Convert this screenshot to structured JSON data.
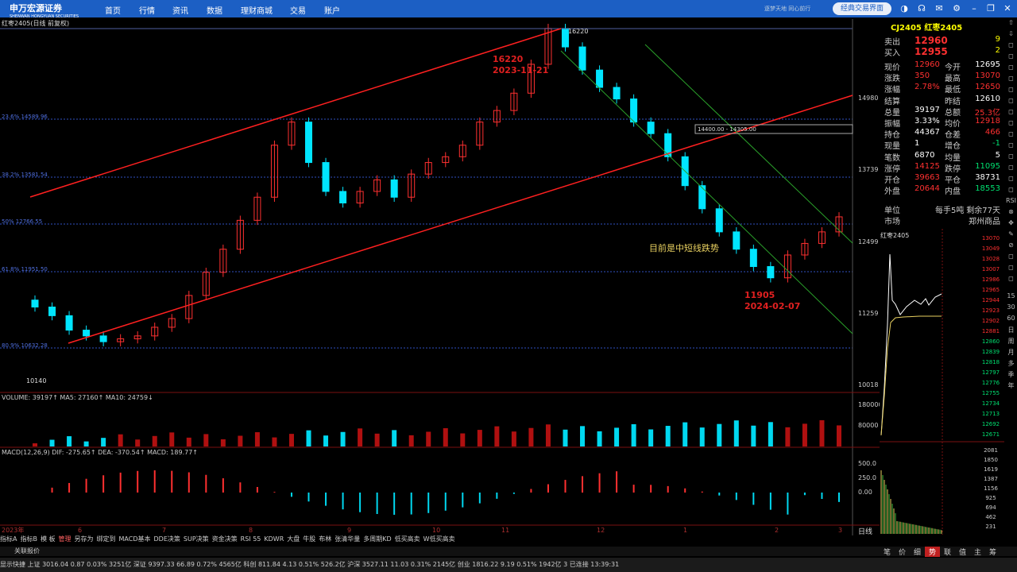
{
  "topbar": {
    "logo": "申万宏源证券",
    "logo_sub": "SHENWAN HONGYUAN SECURITIES",
    "nav": [
      "首页",
      "行情",
      "资讯",
      "数据",
      "理财商城",
      "交易",
      "账户"
    ],
    "slogan": "逐梦天地 同心前行",
    "classic_button": "经典交易界面"
  },
  "chart": {
    "title": "红枣2405(日线 前复权)",
    "fib_levels": [
      "23.6% 14589.96",
      "38.2% 13581.54",
      "50% 12766.55",
      "61.8% 11951.50",
      "80.9% 10632.28"
    ],
    "price_axis": [
      "14980",
      "13739",
      "12499",
      "11259",
      "10018"
    ],
    "peak_label": "16220",
    "low_label": "10140",
    "range_box_label": "14400.00 - 14305.00",
    "annotation_high": [
      "16220",
      "2023-11-21"
    ],
    "annotation_low": [
      "11905",
      "2024-02-07"
    ],
    "trend_note": "目前是中短线跌势",
    "volume_label": "VOLUME: 39197↑  MA5: 27160↑  MA10: 24759↓",
    "volume_axis": [
      "180000",
      "80000"
    ],
    "macd_label": "MACD(12,26,9)  DIF: -275.65↑  DEA: -370.54↑  MACD: 189.77↑",
    "macd_axis": [
      "500.0",
      "250.0",
      "0.00"
    ],
    "x_axis": [
      "2023年",
      "6",
      "7",
      "8",
      "9",
      "10",
      "11",
      "12",
      "1",
      "2",
      "3"
    ]
  },
  "chart_data": {
    "type": "candlestick",
    "colors": {
      "up": "#ff3030",
      "down": "#00e5ff",
      "trend": "#ff2020",
      "channel": "#2aa02a"
    },
    "ohlc_close_approx": [
      11400,
      11250,
      11000,
      10900,
      10800,
      10850,
      10900,
      11050,
      11200,
      11600,
      12000,
      12400,
      12900,
      13300,
      14200,
      14600,
      13900,
      13400,
      13200,
      13400,
      13600,
      13300,
      13700,
      13900,
      14000,
      14200,
      14600,
      14800,
      15100,
      15600,
      16220,
      15900,
      15500,
      15200,
      15000,
      14600,
      14400,
      14000,
      13500,
      13100,
      12700,
      12400,
      12100,
      11905,
      12300,
      12500,
      12700,
      12960
    ]
  },
  "quote": {
    "code": "CJ2405 红枣2405",
    "sell": {
      "label": "卖出",
      "price": "12960",
      "qty": "9"
    },
    "buy": {
      "label": "买入",
      "price": "12955",
      "qty": "2"
    },
    "rows": [
      [
        "现价",
        "12960",
        "今开",
        "12695"
      ],
      [
        "涨跌",
        "350",
        "最高",
        "13070"
      ],
      [
        "涨幅",
        "2.78%",
        "最低",
        "12650"
      ],
      [
        "结算",
        "",
        "昨结",
        "12610"
      ],
      [
        "总量",
        "39197",
        "总额",
        "25.3亿"
      ],
      [
        "振幅",
        "3.33%",
        "均价",
        "12918"
      ],
      [
        "持仓",
        "44367",
        "仓差",
        "466"
      ],
      [
        "现量",
        "1",
        "增仓",
        "-1"
      ],
      [
        "笔数",
        "6870",
        "均量",
        "5"
      ],
      [
        "涨停",
        "14125",
        "跌停",
        "11095"
      ],
      [
        "开仓",
        "39663",
        "平仓",
        "38731"
      ],
      [
        "外盘",
        "20644",
        "内盘",
        "18553"
      ]
    ],
    "unit_label": "单位",
    "unit_value": "每手5吨",
    "remain_value": "剩余77天",
    "market_label": "市场",
    "market_value": "郑州商品"
  },
  "mini": {
    "title": "红枣2405",
    "price_axis": [
      "13070",
      "13049",
      "13028",
      "13007",
      "12986",
      "12965",
      "12944",
      "12923",
      "12902",
      "12881",
      "12860",
      "12839",
      "12818",
      "12797",
      "12776",
      "12755",
      "12734",
      "12713",
      "12692",
      "12671"
    ],
    "vol_axis": [
      "2081",
      "1850",
      "1619",
      "1387",
      "1156",
      "925",
      "694",
      "462",
      "231"
    ]
  },
  "right_icons": [
    "⇧",
    "⇩",
    "◻",
    "◻",
    "◻",
    "◻",
    "◻",
    "◻",
    "◻",
    "◻",
    "◻",
    "◻",
    "◻",
    "◻",
    "◻",
    "◻",
    "RSI",
    "⊗",
    "✥",
    "✎",
    "⊘",
    "◻",
    "◻",
    "◻",
    "15",
    "30",
    "60",
    "日",
    "周",
    "月",
    "多",
    "季",
    "年"
  ],
  "bottom_tabs": [
    "指标A",
    "指标B",
    "模 板",
    "管理",
    "另存为",
    "绑定到",
    "MACD基本",
    "DDE决策",
    "SUP决策",
    "资金决策",
    "RSI 55",
    "KDWR",
    "大盘",
    "牛股",
    "布林",
    "张清华量",
    "多周期KD",
    "低买高卖",
    "W低买高卖"
  ],
  "daily_tab": "日线",
  "related": "关联报价",
  "right_bottom": [
    "笔",
    "价",
    "细",
    "势",
    "联",
    "值",
    "主",
    "筹"
  ],
  "status": "显示快捷  上证 3016.04  0.87  0.03%  3251亿  深证 9397.33  66.89  0.72%  4565亿  科创 811.84  4.13  0.51%  526.2亿  沪深 3527.11  11.03  0.31%  2145亿  创业 1816.22  9.19  0.51%  1942亿     3 已连接     13:39:31"
}
